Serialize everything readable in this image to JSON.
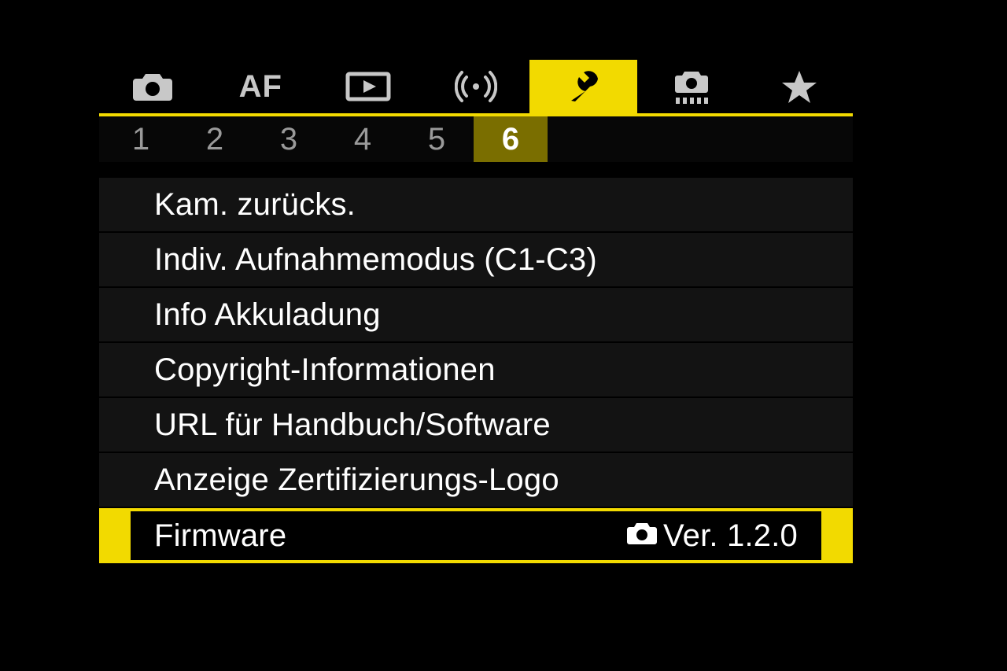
{
  "category_tabs": {
    "active_index": 4,
    "items": [
      {
        "name": "shooting"
      },
      {
        "name": "autofocus",
        "label": "AF"
      },
      {
        "name": "playback"
      },
      {
        "name": "wireless"
      },
      {
        "name": "setup"
      },
      {
        "name": "custom"
      },
      {
        "name": "mymenu"
      }
    ]
  },
  "page_tabs": {
    "active_index": 5,
    "items": [
      "1",
      "2",
      "3",
      "4",
      "5",
      "6"
    ]
  },
  "menu": {
    "items": [
      {
        "label": "Kam. zurücks."
      },
      {
        "label": "Indiv. Aufnahmemodus (C1-C3)"
      },
      {
        "label": "Info Akkuladung"
      },
      {
        "label": "Copyright-Informationen"
      },
      {
        "label": "URL für Handbuch/Software"
      },
      {
        "label": "Anzeige Zertifizierungs-Logo"
      },
      {
        "label": "Firmware",
        "value": "Ver. 1.2.0",
        "selected": true
      }
    ]
  },
  "colors": {
    "accent": "#f2da00",
    "accent_dim": "#7a6e00",
    "bg": "#000000",
    "item_bg": "#131313",
    "text": "#ffffff",
    "icon_inactive": "#c8c8c8"
  }
}
